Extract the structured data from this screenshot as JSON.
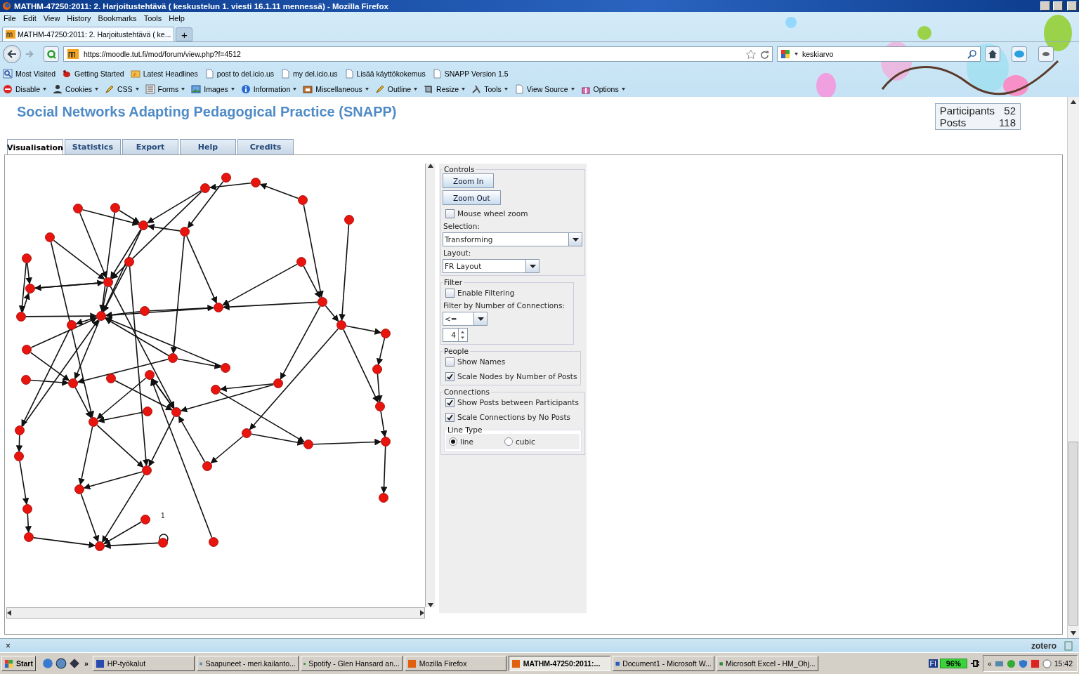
{
  "window": {
    "title": "MATHM-47250:2011: 2. Harjoitustehtävä ( keskustelun 1. viesti 16.1.11 mennessä) - Mozilla Firefox"
  },
  "menu": [
    "File",
    "Edit",
    "View",
    "History",
    "Bookmarks",
    "Tools",
    "Help"
  ],
  "browser_tabs": [
    {
      "label": "MATHM-47250:2011: 2. Harjoitustehtävä ( ke...",
      "selected": true
    }
  ],
  "new_tab": "+",
  "address": "https://moodle.tut.fi/mod/forum/view.php?f=4512",
  "search": {
    "value": "keskiarvo"
  },
  "bookmarks": [
    "Most Visited",
    "Getting Started",
    "Latest Headlines",
    "post to del.icio.us",
    "my del.icio.us",
    "Lisää käyttökokemus",
    "SNAPP Version 1.5"
  ],
  "webdev_toolbar": [
    "Disable",
    "Cookies",
    "CSS",
    "Forms",
    "Images",
    "Information",
    "Miscellaneous",
    "Outline",
    "Resize",
    "Tools",
    "View Source",
    "Options"
  ],
  "snapp": {
    "title": "Social Networks Adapting Pedagogical Practice (SNAPP)",
    "stats": [
      {
        "label": "Participants",
        "value": "52"
      },
      {
        "label": "Posts",
        "value": "118"
      }
    ],
    "tabs": [
      {
        "label": "Visualisation",
        "selected": true
      },
      {
        "label": "Statistics",
        "selected": false
      },
      {
        "label": "Export",
        "selected": false
      },
      {
        "label": "Help",
        "selected": false
      },
      {
        "label": "Credits",
        "selected": false
      }
    ],
    "graph": {
      "edge_label": "1"
    },
    "controls": {
      "title": "Controls",
      "buttons": [
        "Zoom In",
        "Zoom Out"
      ],
      "mouse_wheel": {
        "label": "Mouse wheel zoom",
        "checked": false
      },
      "selection": {
        "label": "Selection:",
        "value": "Transforming"
      },
      "layout": {
        "label": "Layout:",
        "value": "FR Layout"
      }
    },
    "filter": {
      "title": "Filter",
      "enable": {
        "label": "Enable Filtering",
        "checked": false
      },
      "by_label": "Filter by Number of Connections:",
      "operator": "<=",
      "count": "4"
    },
    "people": {
      "title": "People",
      "options": [
        {
          "label": "Show Names",
          "checked": false
        },
        {
          "label": "Scale Nodes by Number of Posts",
          "checked": true
        }
      ]
    },
    "connections": {
      "title": "Connections",
      "options": [
        {
          "label": "Show Posts between Participants",
          "checked": true
        },
        {
          "label": "Scale Connections by No Posts",
          "checked": true
        }
      ],
      "line_type": {
        "title": "Line Type",
        "options": [
          {
            "label": "line",
            "selected": true
          },
          {
            "label": "cubic",
            "selected": false
          }
        ]
      }
    }
  },
  "status_bar": {
    "close": "×",
    "zotero": "zotero"
  },
  "taskbar": {
    "start": "Start",
    "more": "»",
    "tasks": [
      {
        "label": "HP-työkalut",
        "selected": false
      },
      {
        "label": "Saapuneet - meri.kailanto...",
        "selected": false
      },
      {
        "label": "Spotify - Glen Hansard an...",
        "selected": false
      },
      {
        "label": "Mozilla Firefox",
        "selected": false
      },
      {
        "label": "MATHM-47250:2011:...",
        "selected": true
      },
      {
        "label": "Document1 - Microsoft W...",
        "selected": false
      },
      {
        "label": "Microsoft Excel - HM_Ohj...",
        "selected": false
      }
    ],
    "language": "FI",
    "battery": "96%",
    "tray_more": "«",
    "time": "15:42"
  }
}
